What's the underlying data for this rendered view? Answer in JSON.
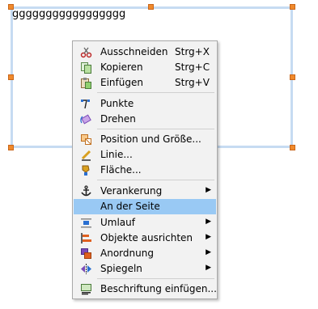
{
  "textframe": {
    "text": "ggggggggggggggggg"
  },
  "menu": {
    "items": [
      {
        "label": "Ausschneiden",
        "shortcut": "Strg+X",
        "icon": "scissors-icon"
      },
      {
        "label": "Kopieren",
        "shortcut": "Strg+C",
        "icon": "copy-icon"
      },
      {
        "label": "Einfügen",
        "shortcut": "Strg+V",
        "icon": "paste-icon"
      },
      {
        "label": "Punkte",
        "icon": "points-icon"
      },
      {
        "label": "Drehen",
        "icon": "rotate-icon"
      },
      {
        "label": "Position und Größe...",
        "icon": "position-size-icon"
      },
      {
        "label": "Linie...",
        "icon": "line-icon"
      },
      {
        "label": "Fläche...",
        "icon": "area-icon"
      },
      {
        "label": "Verankerung",
        "icon": "anchor-icon",
        "submenu": true
      },
      {
        "label": "An der Seite",
        "selected": true
      },
      {
        "label": "Umlauf",
        "icon": "wrap-icon",
        "submenu": true
      },
      {
        "label": "Objekte ausrichten",
        "icon": "align-icon",
        "submenu": true
      },
      {
        "label": "Anordnung",
        "icon": "arrange-icon",
        "submenu": true
      },
      {
        "label": "Spiegeln",
        "icon": "flip-icon",
        "submenu": true
      },
      {
        "label": "Beschriftung einfügen...",
        "icon": "caption-icon"
      }
    ]
  },
  "colors": {
    "accent_selected": "#99c9f4",
    "handle": "#f08a2c",
    "frame_border": "#c6dbf2"
  }
}
